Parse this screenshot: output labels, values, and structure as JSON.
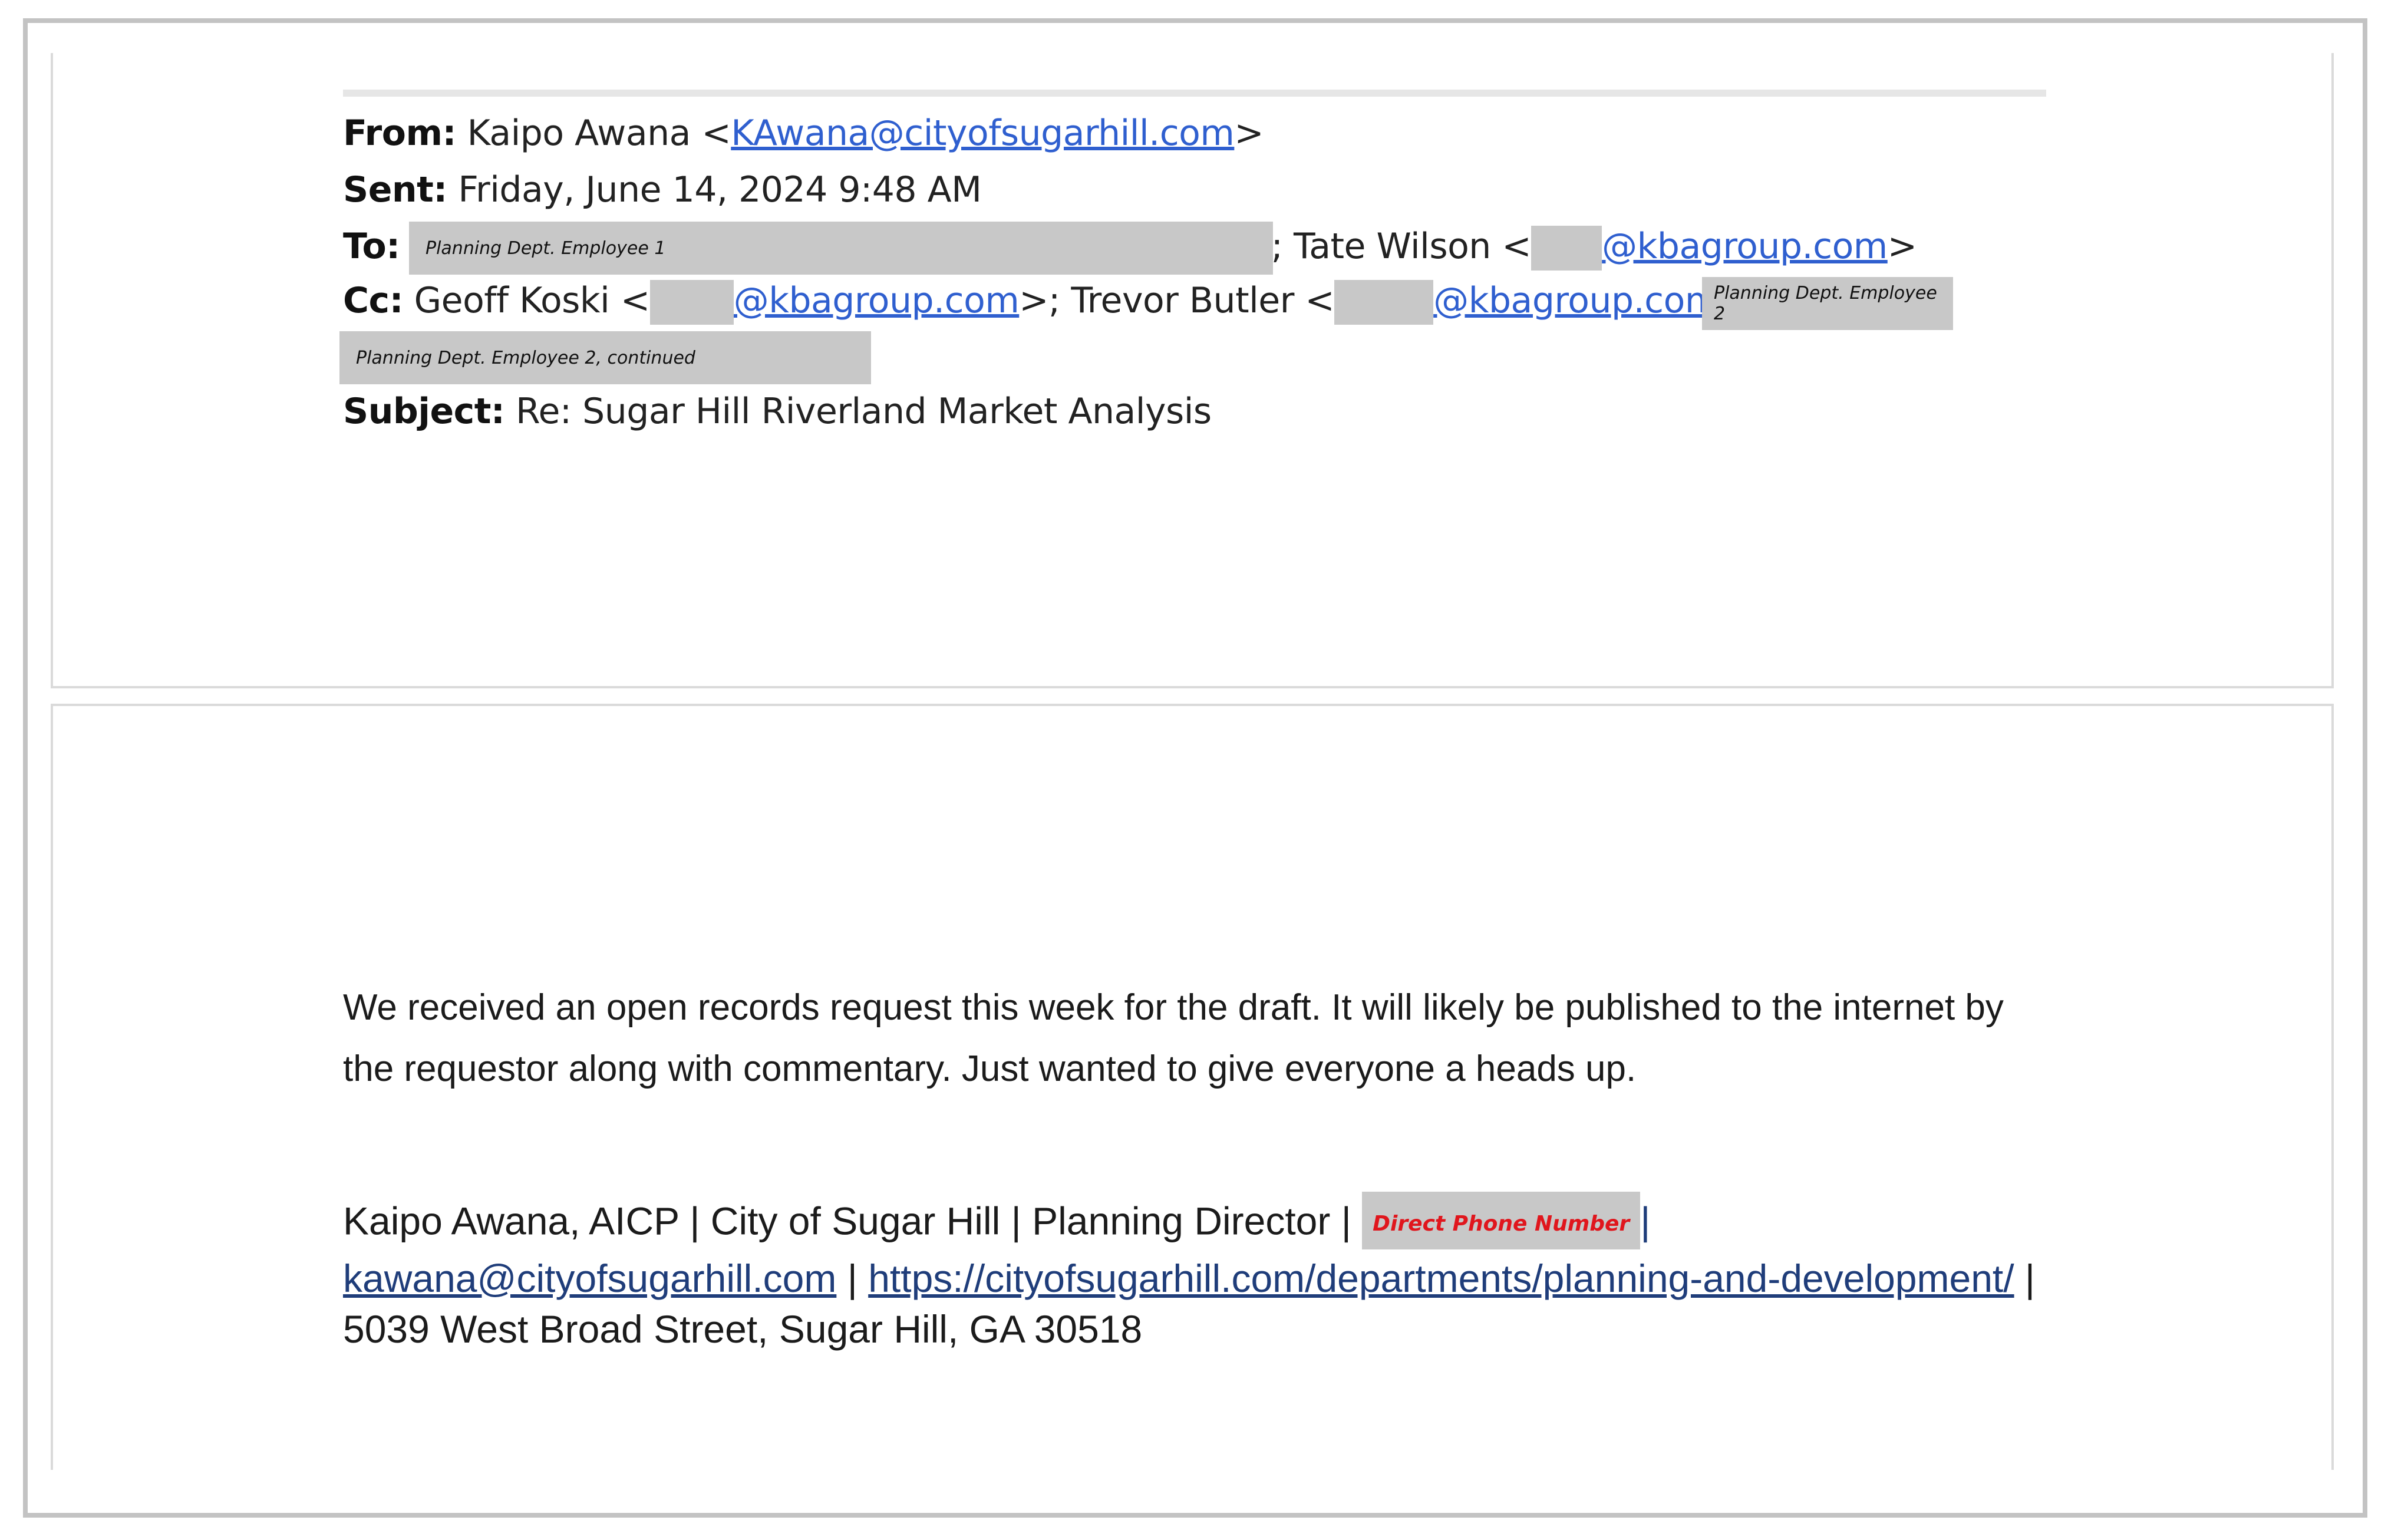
{
  "header": {
    "from_label": "From:",
    "from_name": "Kaipo Awana <",
    "from_email": "KAwana@cityofsugarhill.com",
    "from_close": ">",
    "sent_label": "Sent:",
    "sent_value": "Friday, June 14, 2024 9:48 AM",
    "to_label": "To:",
    "to_redaction_note": "Planning Dept. Employee 1",
    "to_sep": "; Tate Wilson <",
    "to_email_domain": "@kbagroup.com",
    "to_close": ">",
    "cc_label": "Cc:",
    "cc_name1": "Geoff Koski <",
    "cc_email1_domain": "@kbagroup.com",
    "cc_sep": ">; Trevor Butler <",
    "cc_email2_domain": "@kbagroup.com",
    "cc_close": ">;",
    "cc_redaction_note": "Planning Dept. Employee 2",
    "cc_redaction_note_cont": "Planning Dept. Employee 2, continued",
    "subject_label": "Subject:",
    "subject_value": "Re: Sugar Hill Riverland Market Analysis"
  },
  "body": {
    "message": "We received an open records request this week for the draft. It will likely be published to the internet by the requestor along with commentary. Just wanted to give everyone a heads up."
  },
  "signature": {
    "line1": "Kaipo Awana, AICP | City of Sugar Hill | Planning Director |",
    "phone_redaction_note": "Direct Phone Number",
    "pipe_after_phone": "|",
    "email": "kawana@cityofsugarhill.com",
    "sep": "|",
    "url": "https://cityofsugarhill.com/departments/planning-and-development/",
    "address": "| 5039 West Broad Street, Sugar Hill, GA 30518"
  },
  "colors": {
    "link": "#2f5fcf",
    "redaction": "#c8c8c8",
    "phone_note": "#e0161d"
  }
}
